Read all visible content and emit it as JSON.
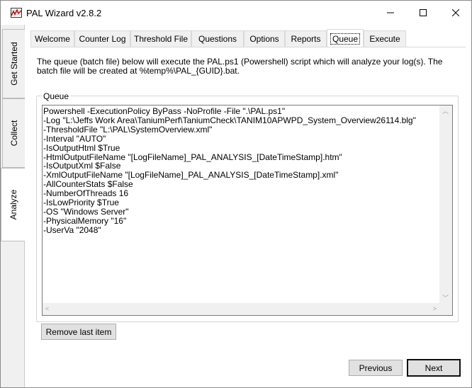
{
  "window": {
    "title": "PAL Wizard v2.8.2",
    "icon": "pal-chart-icon",
    "controls": [
      "minimize-icon",
      "maximize-icon",
      "close-icon"
    ]
  },
  "side_tabs": [
    {
      "label": "Get Started",
      "active": false
    },
    {
      "label": "Collect",
      "active": false
    },
    {
      "label": "Analyze",
      "active": true
    }
  ],
  "tabs": [
    {
      "label": "Welcome",
      "active": false
    },
    {
      "label": "Counter Log",
      "active": false
    },
    {
      "label": "Threshold File",
      "active": false
    },
    {
      "label": "Questions",
      "active": false
    },
    {
      "label": "Options",
      "active": false
    },
    {
      "label": "Reports",
      "active": false
    },
    {
      "label": "Queue",
      "active": true
    },
    {
      "label": "Execute",
      "active": false
    }
  ],
  "description": "The queue (batch file) below will execute the PAL.ps1 (Powershell) script which will analyze your log(s). The batch file will be created at %temp%\\PAL_{GUID}.bat.",
  "queue": {
    "label": "Queue",
    "lines": [
      "Powershell -ExecutionPolicy ByPass -NoProfile -File \".\\PAL.ps1\"",
      "-Log \"L:\\Jeffs Work Area\\TaniumPerf\\TaniumCheck\\TANIM10APWPD_System_Overview26114.blg\"",
      "-ThresholdFile \"L:\\PAL\\SystemOverview.xml\"",
      "-Interval \"AUTO\"",
      "-IsOutputHtml $True",
      "-HtmlOutputFileName \"[LogFileName]_PAL_ANALYSIS_[DateTimeStamp].htm\"",
      "-IsOutputXml $False",
      "-XmlOutputFileName \"[LogFileName]_PAL_ANALYSIS_[DateTimeStamp].xml\"",
      "-AllCounterStats $False",
      "-NumberOfThreads 16",
      "-IsLowPriority $True",
      "-OS \"Windows Server\"",
      "-PhysicalMemory \"16\"",
      "-UserVa \"2048\""
    ]
  },
  "buttons": {
    "remove_last": "Remove last item",
    "previous": "Previous",
    "next": "Next"
  }
}
